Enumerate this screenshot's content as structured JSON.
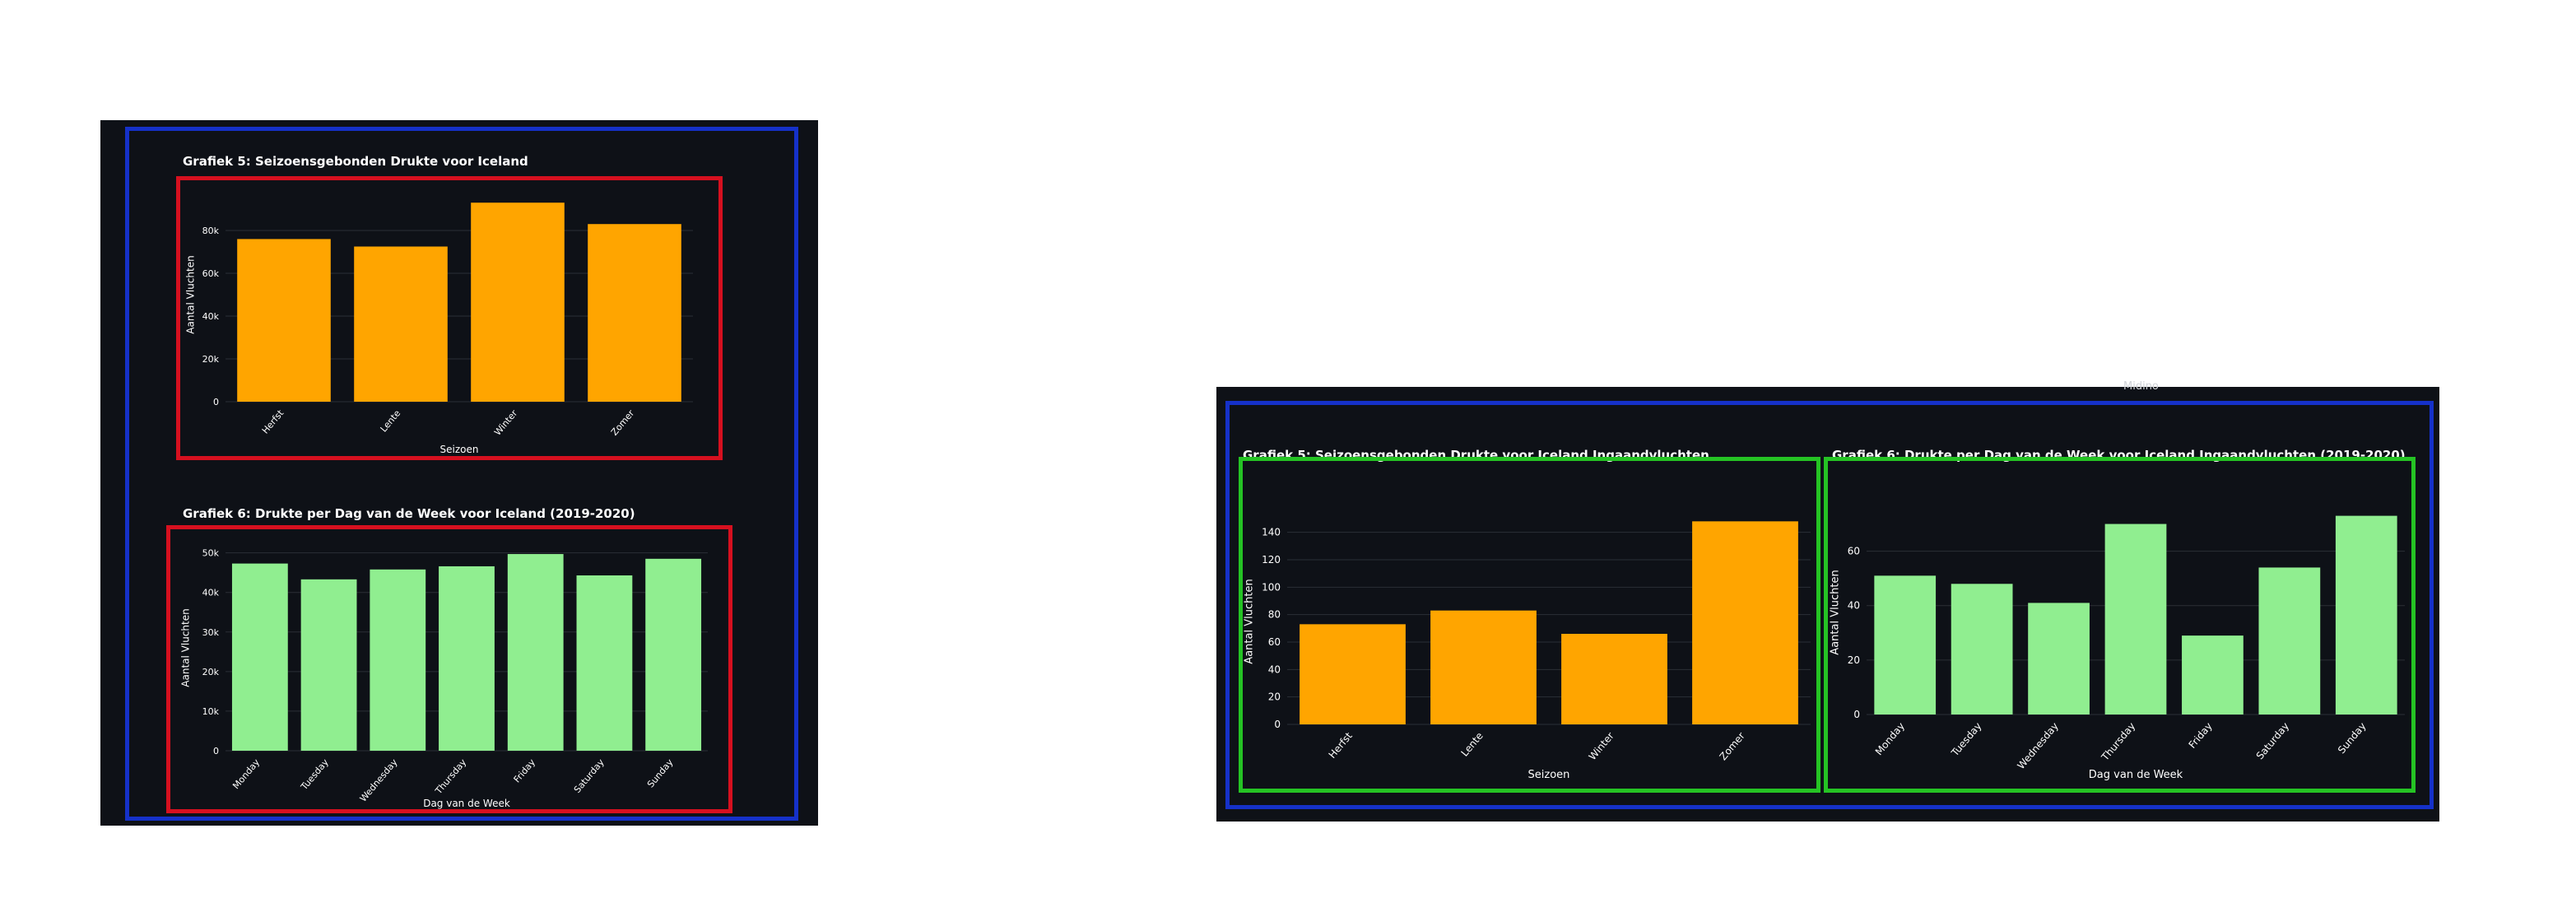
{
  "top_label": "Midino",
  "colors": {
    "orange": "#FFA500",
    "green": "#90EE90",
    "text": "#ffffff",
    "grid": "#2b2f37"
  },
  "chart_data": [
    {
      "id": "c1",
      "type": "bar",
      "title": "Grafiek 5: Seizoensgebonden Drukte voor Iceland",
      "xlabel": "Seizoen",
      "ylabel": "Aantal Vluchten",
      "categories": [
        "Herfst",
        "Lente",
        "Winter",
        "Zomer"
      ],
      "values": [
        76000,
        72500,
        93000,
        83000
      ],
      "ylim": [
        0,
        100000
      ],
      "yticks": [
        0,
        20000,
        40000,
        60000,
        80000
      ],
      "yticklabels": [
        "0",
        "20k",
        "40k",
        "60k",
        "80k"
      ],
      "color": "#FFA500",
      "grid": true
    },
    {
      "id": "c2",
      "type": "bar",
      "title": "Grafiek 6: Drukte per Dag van de Week voor Iceland (2019-2020)",
      "xlabel": "Dag van de Week",
      "ylabel": "Aantal Vluchten",
      "categories": [
        "Monday",
        "Tuesday",
        "Wednesday",
        "Thursday",
        "Friday",
        "Saturday",
        "Sunday"
      ],
      "values": [
        47300,
        43300,
        45800,
        46600,
        49700,
        44300,
        48500
      ],
      "ylim": [
        0,
        52000
      ],
      "yticks": [
        0,
        10000,
        20000,
        30000,
        40000,
        50000
      ],
      "yticklabels": [
        "0",
        "10k",
        "20k",
        "30k",
        "40k",
        "50k"
      ],
      "color": "#90EE90",
      "grid": true
    },
    {
      "id": "c3",
      "type": "bar",
      "title": "Grafiek 5: Seizoensgebonden Drukte voor Iceland Ingaandvluchten",
      "xlabel": "Seizoen",
      "ylabel": "Aantal Vluchten",
      "categories": [
        "Herfst",
        "Lente",
        "Winter",
        "Zomer"
      ],
      "values": [
        73,
        83,
        66,
        148
      ],
      "ylim": [
        0,
        150
      ],
      "yticks": [
        0,
        20,
        40,
        60,
        80,
        100,
        120,
        140
      ],
      "yticklabels": [
        "0",
        "20",
        "40",
        "60",
        "80",
        "100",
        "120",
        "140"
      ],
      "color": "#FFA500",
      "grid": true
    },
    {
      "id": "c4",
      "type": "bar",
      "title": "Grafiek 6: Drukte per Dag van de Week voor Iceland Ingaandvluchten (2019-2020)",
      "xlabel": "Dag van de Week",
      "ylabel": "Aantal Vluchten",
      "categories": [
        "Monday",
        "Tuesday",
        "Wednesday",
        "Thursday",
        "Friday",
        "Saturday",
        "Sunday"
      ],
      "values": [
        51,
        48,
        41,
        70,
        29,
        54,
        73
      ],
      "ylim": [
        0,
        75
      ],
      "yticks": [
        0,
        20,
        40,
        60
      ],
      "yticklabels": [
        "0",
        "20",
        "40",
        "60"
      ],
      "color": "#90EE90",
      "grid": true
    }
  ]
}
